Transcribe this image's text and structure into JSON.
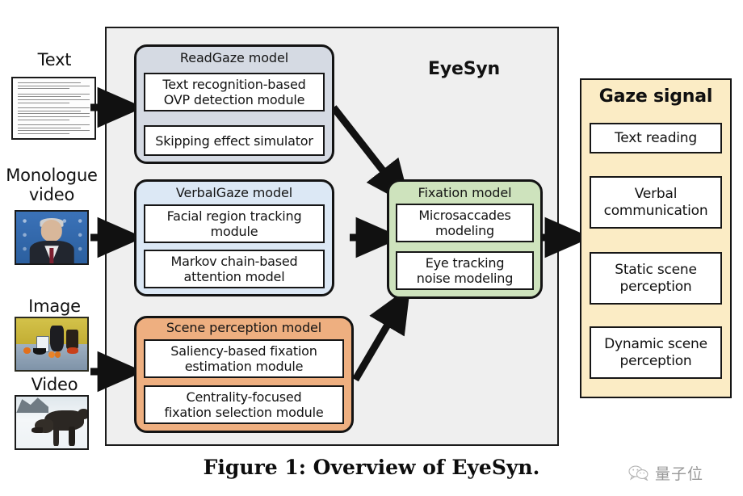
{
  "figure": {
    "caption": "Figure 1: Overview of EyeSyn.",
    "container_label": "EyeSyn"
  },
  "inputs": [
    {
      "label": "Text",
      "thumb": "text-page-thumbnail"
    },
    {
      "label": "Monologue\nvideo",
      "label_line1": "Monologue",
      "label_line2": "video",
      "thumb": "monologue-video-thumbnail"
    },
    {
      "label": "Image",
      "thumb": "still-life-image-thumbnail"
    },
    {
      "label": "Video",
      "thumb": "wolf-video-thumbnail"
    }
  ],
  "models": [
    {
      "id": "readgaze",
      "title": "ReadGaze model",
      "color": "#d5dae3",
      "modules": [
        {
          "line1": "Text recognition-based",
          "line2": "OVP detection module"
        },
        {
          "line1": "Skipping effect simulator",
          "line2": ""
        }
      ]
    },
    {
      "id": "verbalgaze",
      "title": "VerbalGaze model",
      "color": "#dce8f5",
      "modules": [
        {
          "line1": "Facial region tracking",
          "line2": "module"
        },
        {
          "line1": "Markov chain-based",
          "line2": "attention model"
        }
      ]
    },
    {
      "id": "scene-perception",
      "title": "Scene perception model",
      "color": "#eeaf80",
      "modules": [
        {
          "line1": "Saliency-based fixation",
          "line2": "estimation module"
        },
        {
          "line1": "Centrality-focused",
          "line2": "fixation selection module"
        }
      ]
    },
    {
      "id": "fixation",
      "title": "Fixation model",
      "color": "#cee3bd",
      "modules": [
        {
          "line1": "Microsaccades",
          "line2": "modeling"
        },
        {
          "line1": "Eye tracking",
          "line2": "noise modeling"
        }
      ]
    }
  ],
  "gaze_signal": {
    "title": "Gaze signal",
    "items": [
      {
        "line1": "Text reading",
        "line2": ""
      },
      {
        "line1": "Verbal",
        "line2": "communication"
      },
      {
        "line1": "Static scene",
        "line2": "perception"
      },
      {
        "line1": "Dynamic scene",
        "line2": "perception"
      }
    ]
  },
  "watermark": {
    "text": "量子位",
    "icon": "wechat-icon"
  },
  "colors": {
    "container_bg": "#efefef",
    "readgaze": "#d5dae3",
    "verbalgaze": "#dce8f5",
    "scene": "#eeaf80",
    "fixation": "#cee3bd",
    "gaze_signal": "#fbecc5",
    "stroke": "#151515"
  }
}
